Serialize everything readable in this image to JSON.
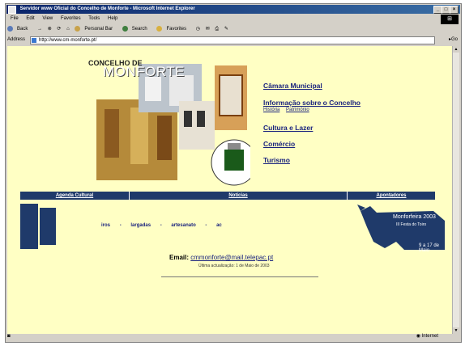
{
  "window": {
    "title": "Servidor www Oficial do Concelho de Monforte - Microsoft Internet Explorer",
    "menu": [
      "File",
      "Edit",
      "View",
      "Favorites",
      "Tools",
      "Help"
    ],
    "toolbar": [
      "Back",
      "Personal Bar",
      "Search",
      "Favorites"
    ],
    "address_label": "Address",
    "address_value": "http://www.cm-monforte.pt/",
    "go_label": "Go",
    "status": "Internet"
  },
  "page": {
    "header_line1": "CONCELHO DE",
    "header_line2": "MONFORTE",
    "nav": [
      {
        "label": "Câmara Municipal"
      },
      {
        "label": "Informação sobre o Concelho"
      },
      {
        "label": "Cultura e Lazer"
      },
      {
        "label": "Comércio"
      },
      {
        "label": "Turismo"
      }
    ],
    "nav_sub": [
      "História",
      "Património"
    ],
    "bluebar": [
      "Agenda Cultural",
      "Notícias",
      "Apontadores"
    ],
    "ticker": [
      "iros",
      "-",
      "largadas",
      "-",
      "artesanato",
      "-",
      "ac"
    ],
    "promo": {
      "line1": "Monforfeira 2003",
      "line2": "III Festa do Toiro",
      "line3": "9 a 17 de Maio"
    },
    "email_label": "Email:",
    "email_address": "cmmonforte@mail.telepac.pt",
    "updated": "Última actualização: 1 de Maio de 2003"
  }
}
